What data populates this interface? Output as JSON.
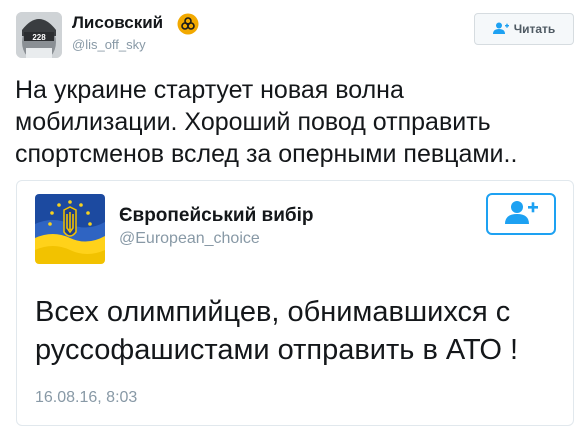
{
  "tweet": {
    "author": {
      "name": "Лисовский",
      "handle": "@lis_off_sky",
      "badge_icon": "biohazard-icon",
      "badge_color": "#f2a900",
      "avatar_text": "228"
    },
    "follow_button": {
      "label": "Читать",
      "icon": "add-user-icon"
    },
    "text": "На украине стартует новая волна\nмобилизации. Хороший повод отправить\nспортсменов вслед за оперными певцами..",
    "quoted": {
      "author": {
        "name": "Європейський вибір",
        "handle": "@European_choice"
      },
      "follow_icon": "add-user-icon",
      "accent_color": "#1da1f2",
      "text": "Всех олимпийцев, обнимавшихся с\nруссофашистами отправить в АТО !",
      "timestamp": "16.08.16, 8:03"
    }
  }
}
